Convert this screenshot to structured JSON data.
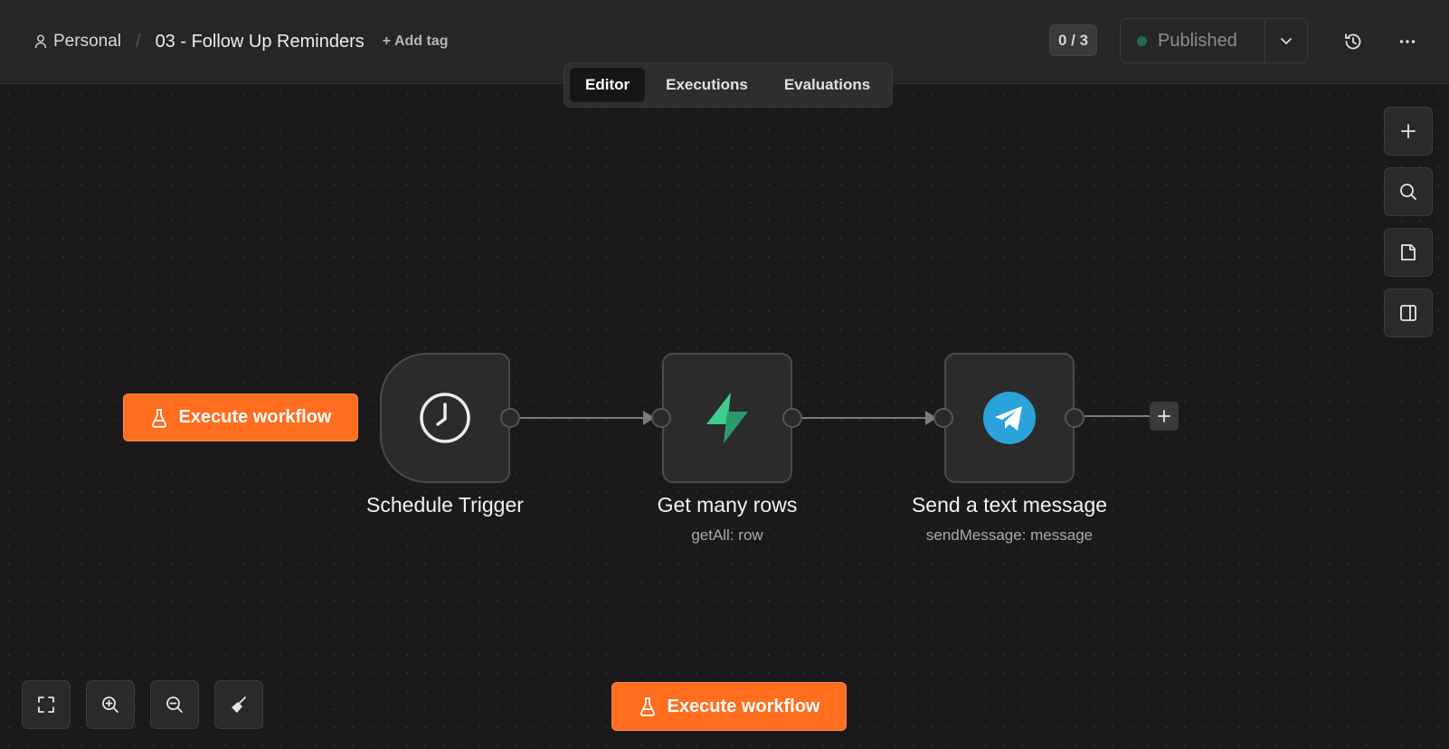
{
  "header": {
    "project": "Personal",
    "workflow_title": "03 - Follow Up Reminders",
    "add_tag_label": "+ Add tag",
    "counter": "0 / 3",
    "publish_label": "Published"
  },
  "tabs": [
    {
      "label": "Editor",
      "active": true
    },
    {
      "label": "Executions",
      "active": false
    },
    {
      "label": "Evaluations",
      "active": false
    }
  ],
  "canvas": {
    "execute_button_label": "Execute workflow",
    "nodes": [
      {
        "label": "Schedule Trigger",
        "subtitle": "",
        "icon": "clock-icon"
      },
      {
        "label": "Get many rows",
        "subtitle": "getAll: row",
        "icon": "supabase-icon"
      },
      {
        "label": "Send a text message",
        "subtitle": "sendMessage: message",
        "icon": "telegram-icon"
      }
    ]
  },
  "colors": {
    "accent": "#ff6d1f",
    "supabase": "#3ecf8e",
    "telegram": "#2aa3db",
    "status_dot": "#1f6b56"
  }
}
